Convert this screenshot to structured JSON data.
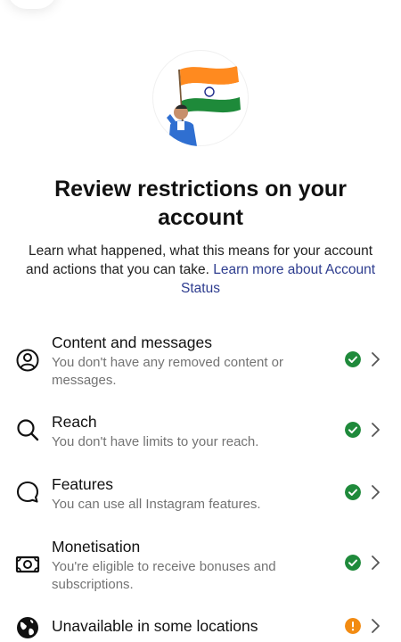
{
  "header": {
    "title": "Review restrictions on your account",
    "description": "Learn what happened, what this means for your account and actions that you can take.",
    "link_text": "Learn more about Account Status"
  },
  "rows": [
    {
      "title": "Content and messages",
      "description": "You don't have any removed content or messages.",
      "icon": "user-circle-icon",
      "status": "ok"
    },
    {
      "title": "Reach",
      "description": "You don't have limits to your reach.",
      "icon": "search-icon",
      "status": "ok"
    },
    {
      "title": "Features",
      "description": "You can use all Instagram features.",
      "icon": "chat-bubble-icon",
      "status": "ok"
    },
    {
      "title": "Monetisation",
      "description": "You're eligible to receive bonuses and subscriptions.",
      "icon": "money-icon",
      "status": "ok"
    },
    {
      "title": "Unavailable in some locations",
      "description": "",
      "icon": "globe-icon",
      "status": "warning"
    }
  ],
  "colors": {
    "ok": "#1f8a3b",
    "warning": "#f28b12",
    "link": "#2e3d8f",
    "secondary_text": "#737373"
  }
}
